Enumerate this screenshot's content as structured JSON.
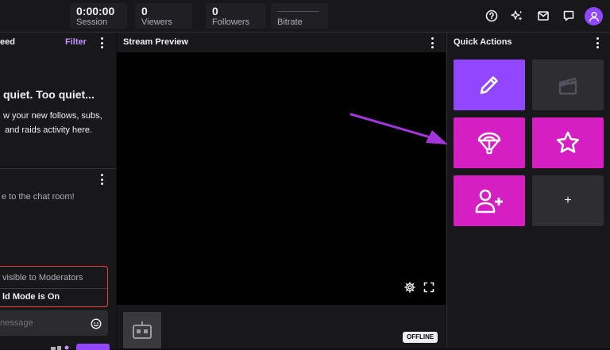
{
  "topbar": {
    "session": {
      "value": "0:00:00",
      "label": "Session"
    },
    "viewers": {
      "value": "0",
      "label": "Viewers"
    },
    "followers": {
      "value": "0",
      "label": "Followers"
    },
    "bitrate": {
      "label": "Bitrate"
    }
  },
  "feed": {
    "title": "eed",
    "filter_label": "Filter",
    "quiet_text": "quiet. Too quiet...",
    "desc_line1": "w your new follows, subs,",
    "desc_line2": "and raids activity here."
  },
  "chat": {
    "welcome": "e to the chat room!",
    "mod_notice": "visible to Moderators",
    "mode_notice": "ld Mode is On",
    "input_placeholder": "nessage"
  },
  "preview": {
    "title": "Stream Preview",
    "status_badge": "OFFLINE"
  },
  "quick_actions": {
    "title": "Quick Actions",
    "add_label": "+"
  },
  "colors": {
    "accent": "#9147ff",
    "pink": "#d61fc3",
    "arrow": "#a236d8"
  }
}
